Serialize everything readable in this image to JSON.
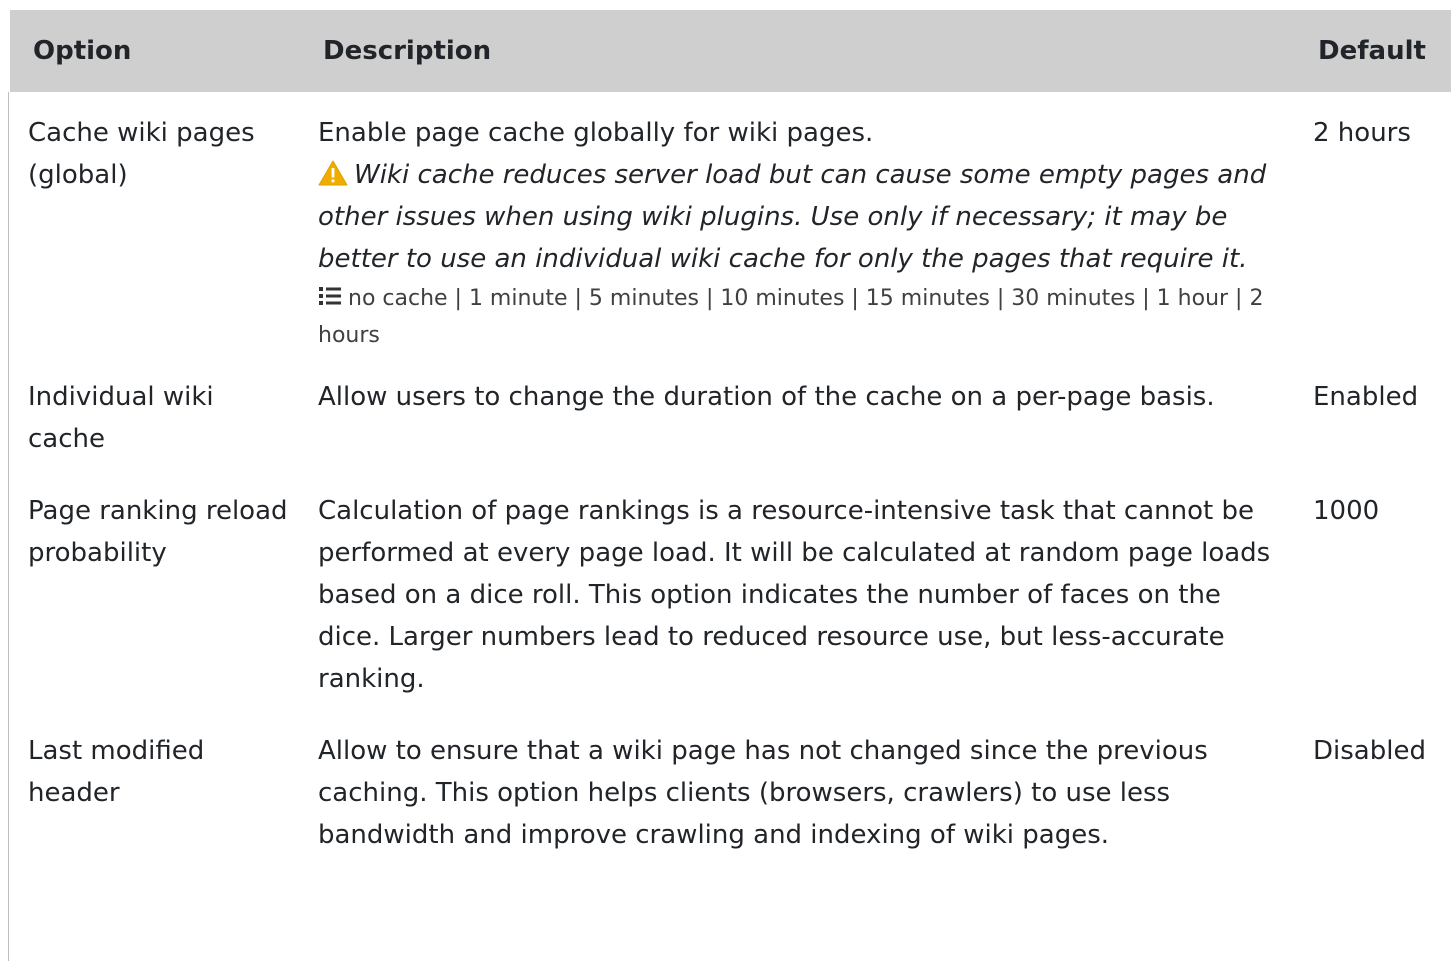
{
  "table": {
    "headers": {
      "option": "Option",
      "description": "Description",
      "default": "Default"
    },
    "rows": [
      {
        "option": "Cache wiki pages (global)",
        "description": "Enable page cache globally for wiki pages.",
        "warning": "Wiki cache reduces server load but can cause some empty pages and other issues when using wiki plugins. Use only if necessary; it may be better to use an individual wiki cache for only the pages that require it.",
        "choices": "no cache | 1 minute | 5 minutes | 10 minutes | 15 minutes | 30 minutes | 1 hour | 2 hours",
        "default": "2 hours"
      },
      {
        "option": "Individual wiki cache",
        "description": "Allow users to change the duration of the cache on a per-page basis.",
        "default": "Enabled"
      },
      {
        "option": "Page ranking reload probability",
        "description": "Calculation of page rankings is a resource-intensive task that cannot be performed at every page load. It will be calculated at random page loads based on a dice roll. This option indicates the number of faces on the dice. Larger numbers lead to reduced resource use, but less-accurate ranking.",
        "default": "1000"
      },
      {
        "option": "Last modified header",
        "description": "Allow to ensure that a wiki page has not changed since the previous caching. This option helps clients (browsers, crawlers) to use less bandwidth and improve crawling and indexing of wiki pages.",
        "default": "Disabled"
      }
    ]
  },
  "icons": {
    "warning": "warning-triangle-icon",
    "choices": "list-icon"
  },
  "colors": {
    "header_bg": "#cfcfcf",
    "warning_icon": "#f0ad00",
    "text": "#212529"
  }
}
